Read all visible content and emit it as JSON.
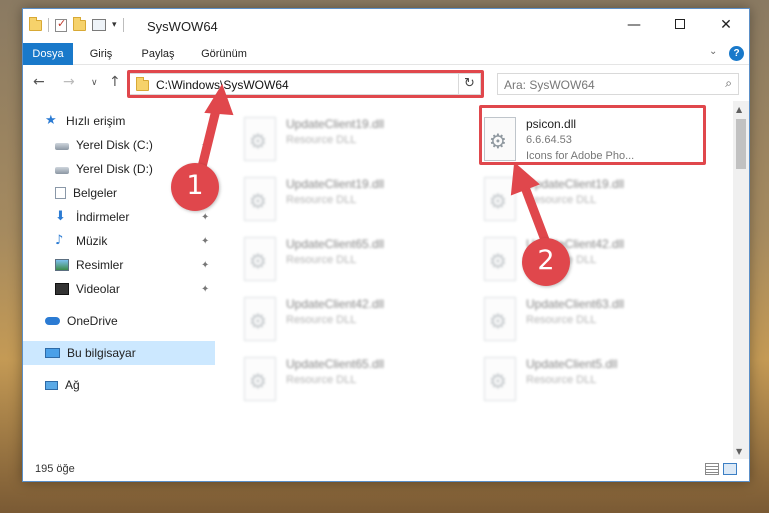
{
  "window": {
    "title": "SysWOW64",
    "minimize": "—",
    "maximize": "",
    "close": "✕"
  },
  "ribbon": {
    "tabs": [
      "Dosya",
      "Giriş",
      "Paylaş",
      "Görünüm"
    ],
    "active_tab": "Dosya",
    "help": "?"
  },
  "nav": {
    "back": "←",
    "forward": "→",
    "recent": "∨",
    "up": "↑"
  },
  "address": {
    "path": "C:\\Windows\\SysWOW64",
    "refresh": "↻"
  },
  "search": {
    "placeholder": "Ara: SysWOW64",
    "icon": "⌕"
  },
  "sidebar": {
    "items": [
      {
        "label": "Hızlı erişim",
        "icon": "star-icon"
      },
      {
        "label": "Yerel Disk (C:)",
        "icon": "drive-icon",
        "pinned": true
      },
      {
        "label": "Yerel Disk (D:)",
        "icon": "drive-icon",
        "pinned": true
      },
      {
        "label": "Belgeler",
        "icon": "documents-icon",
        "pinned": true
      },
      {
        "label": "İndirmeler",
        "icon": "downloads-icon",
        "pinned": true
      },
      {
        "label": "Müzik",
        "icon": "music-icon",
        "pinned": true
      },
      {
        "label": "Resimler",
        "icon": "pictures-icon",
        "pinned": true
      },
      {
        "label": "Videolar",
        "icon": "videos-icon",
        "pinned": true
      },
      {
        "label": "OneDrive",
        "icon": "cloud-icon"
      },
      {
        "label": "Bu bilgisayar",
        "icon": "computer-icon",
        "selected": true
      },
      {
        "label": "Ağ",
        "icon": "network-icon"
      }
    ],
    "pin_glyph": "📌"
  },
  "files": [
    {
      "name": "UpdateClient19.dll",
      "desc": "Resource DLL",
      "blurred": true
    },
    {
      "name": "psicon.dll",
      "version": "6.6.64.53",
      "desc": "Icons for Adobe Pho...",
      "blurred": false
    },
    {
      "name": "UpdateClient19.dll",
      "desc": "Resource DLL",
      "blurred": true
    },
    {
      "name": "UpdateClient19.dll",
      "desc": "Resource DLL",
      "blurred": true
    },
    {
      "name": "UpdateClient65.dll",
      "desc": "Resource DLL",
      "blurred": true
    },
    {
      "name": "UpdateClient42.dll",
      "desc": "Resource DLL",
      "blurred": true
    },
    {
      "name": "UpdateClient42.dll",
      "desc": "Resource DLL",
      "blurred": true
    },
    {
      "name": "UpdateClient63.dll",
      "desc": "Resource DLL",
      "blurred": true
    },
    {
      "name": "UpdateClient65.dll",
      "desc": "Resource DLL",
      "blurred": true
    },
    {
      "name": "UpdateClient5.dll",
      "desc": "Resource DLL",
      "blurred": true
    }
  ],
  "status": {
    "count": "195 öğe"
  },
  "callouts": [
    "1",
    "2"
  ],
  "colors": {
    "accent": "#1979ca",
    "highlight": "#e0474c",
    "selected": "#cce8ff"
  }
}
